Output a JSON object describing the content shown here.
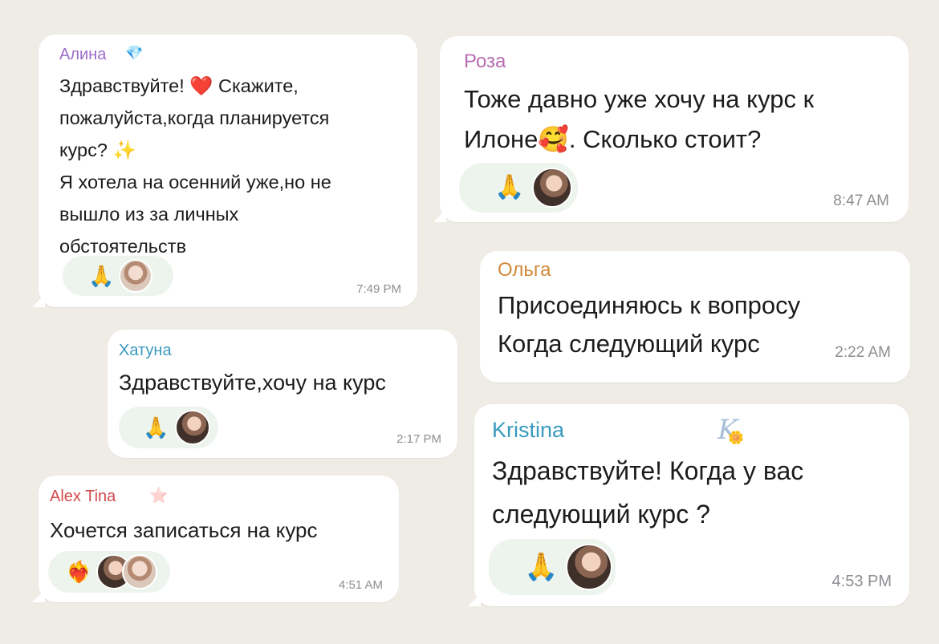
{
  "messages": [
    {
      "id": "alina",
      "name": "Алина",
      "name_color": "#9b6cc8",
      "name_badge_icon": "gem-icon",
      "text": "Здравствуйте! ❤️ Скажите,\nпожалуйста,когда планируется\nкурс? ✨\nЯ хотела на осенний уже,но не\nвышло из за личных\nобстоятельств",
      "reaction_emoji": "🙏",
      "time": "7:49 PM"
    },
    {
      "id": "roza",
      "name": "Роза",
      "name_color": "#b86cb4",
      "text": "Тоже давно уже хочу на курс к\nИлоне🥰. Сколько стоит?",
      "reaction_emoji": "🙏",
      "time": "8:47 AM"
    },
    {
      "id": "olga",
      "name": "Ольга",
      "name_color": "#d08a3a",
      "text": "Присоединяюсь к вопросу\nКогда следующий курс",
      "time": "2:22 AM"
    },
    {
      "id": "khatuna",
      "name": "Хатуна",
      "name_color": "#3a9abd",
      "text": "Здравствуйте,хочу на курс",
      "reaction_emoji": "🙏",
      "time": "2:17 PM"
    },
    {
      "id": "kristina",
      "name": "Kristina",
      "name_color": "#3a9abd",
      "name_badge_icon": "flower-letter-k-icon",
      "text": "Здравствуйте! Когда у вас\nследующий курс ?",
      "reaction_emoji": "🙏",
      "time": "4:53 PM"
    },
    {
      "id": "alextina",
      "name": "Alex Tina",
      "name_color": "#d24a4a",
      "name_badge_icon": "star-icon",
      "text": "Хочется записаться на курс",
      "reaction_emoji": "❤️‍🔥",
      "time": "4:51 AM"
    }
  ],
  "icons": {
    "gem": "💎",
    "star": "⭐",
    "flower": "🌼"
  },
  "colors": {
    "background": "#efece6",
    "bubble": "#ffffff",
    "reaction_pill": "#edf4ee",
    "time": "#8e8e93"
  }
}
